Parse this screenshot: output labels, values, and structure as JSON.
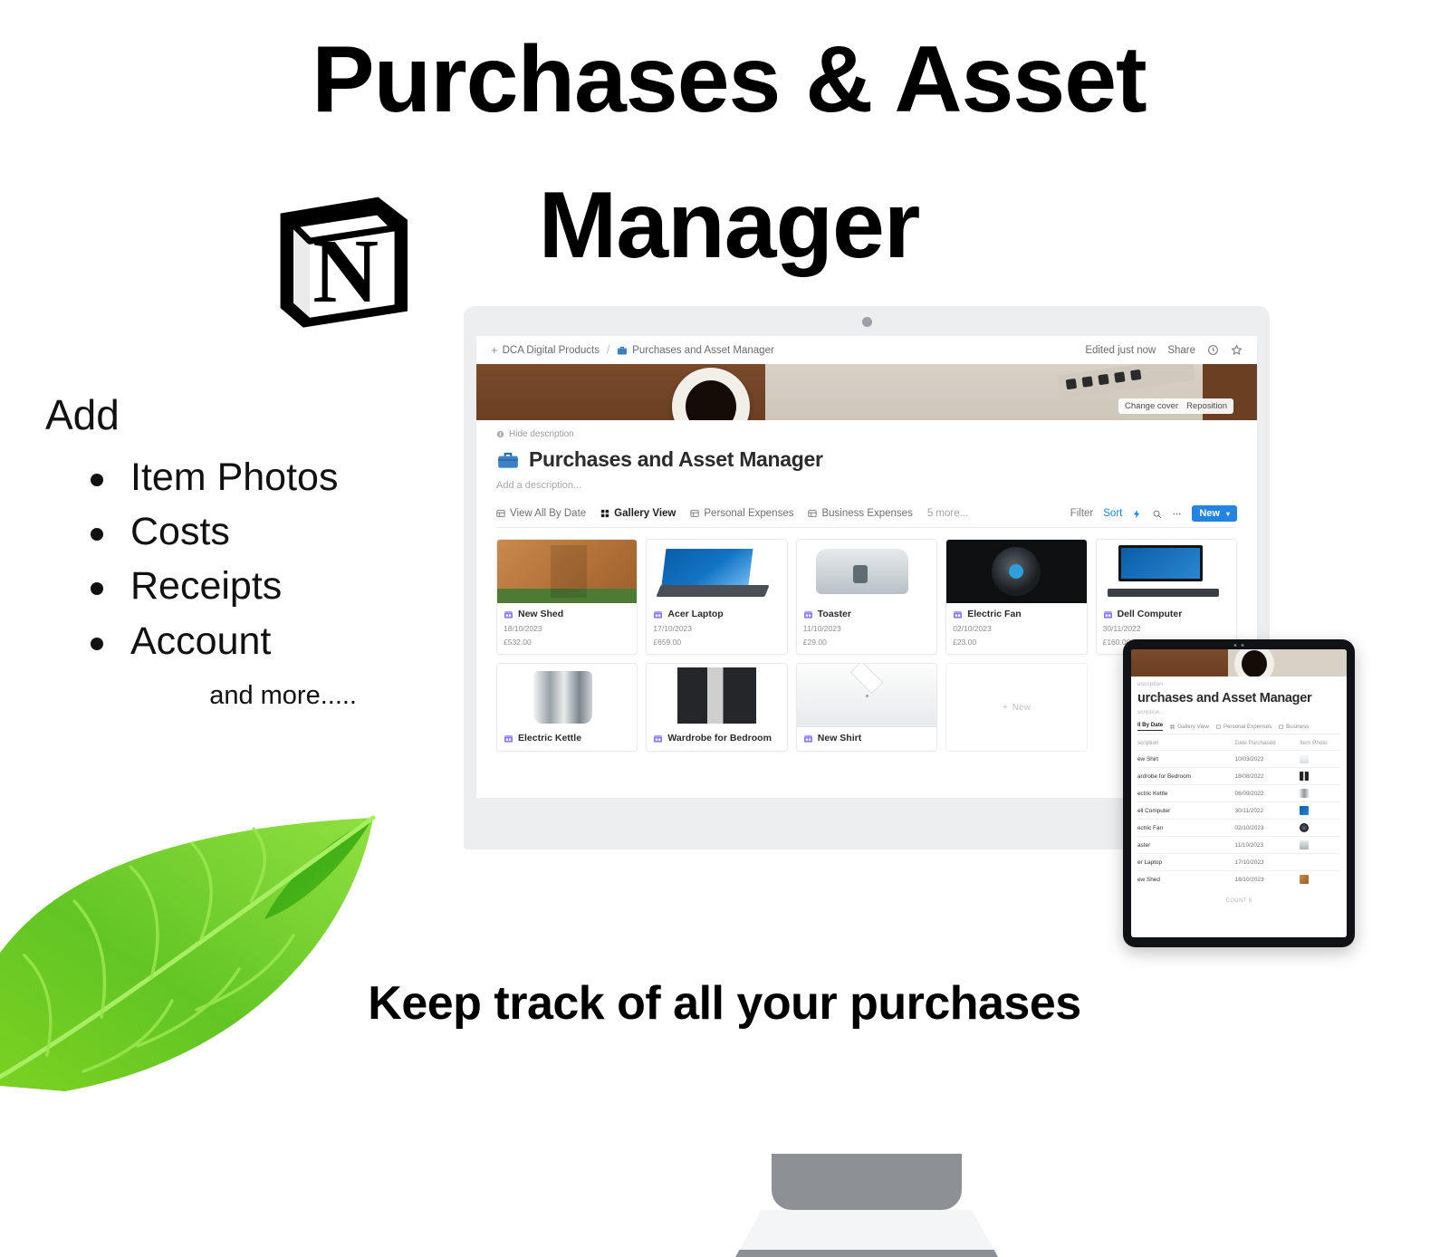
{
  "hero": {
    "title_line1": "Purchases & Asset",
    "title_line2": "Manager",
    "logo_name": "notion-logo"
  },
  "features": {
    "heading": "Add",
    "items": [
      "Item Photos",
      "Costs",
      "Receipts",
      "Account"
    ],
    "more": "and more....."
  },
  "tagline": "Keep track of all your purchases",
  "notion": {
    "breadcrumb": {
      "plus": "+",
      "workspace": "DCA Digital Products",
      "separator": "/",
      "page": "Purchases and Asset Manager"
    },
    "topbar_right": {
      "edited": "Edited just now",
      "share": "Share",
      "comment_icon": "clock-icon",
      "favorite_icon": "star-icon"
    },
    "cover": {
      "change_cover": "Change cover",
      "reposition": "Reposition"
    },
    "hide_description": "Hide description",
    "page_title": "Purchases and Asset Manager",
    "description_placeholder": "Add a description...",
    "tabs": [
      {
        "label": "View All By Date",
        "icon": "table-icon",
        "active": false
      },
      {
        "label": "Gallery View",
        "icon": "gallery-icon",
        "active": true
      },
      {
        "label": "Personal Expenses",
        "icon": "table-icon",
        "active": false
      },
      {
        "label": "Business Expenses",
        "icon": "table-icon",
        "active": false
      }
    ],
    "more_tabs": "5 more...",
    "tools": {
      "filter": "Filter",
      "sort": "Sort",
      "lightning_icon": "lightning-icon",
      "search_icon": "search-icon",
      "more_icon": "ellipsis-icon",
      "new_label": "New",
      "new_chevron": "▾"
    },
    "cards": [
      {
        "name": "New Shed",
        "date": "18/10/2023",
        "price": "£532.00",
        "thumb": "shed"
      },
      {
        "name": "Acer Laptop",
        "date": "17/10/2023",
        "price": "£659.00",
        "thumb": "laptop"
      },
      {
        "name": "Toaster",
        "date": "11/10/2023",
        "price": "£29.00",
        "thumb": "toaster"
      },
      {
        "name": "Electric Fan",
        "date": "02/10/2023",
        "price": "£23.00",
        "thumb": "fan"
      },
      {
        "name": "Dell Computer",
        "date": "30/11/2022",
        "price": "£160.00",
        "thumb": "dell"
      },
      {
        "name": "Electric Kettle",
        "date": "",
        "price": "",
        "thumb": "kettle"
      },
      {
        "name": "Wardrobe for Bedroom",
        "date": "",
        "price": "",
        "thumb": "wardrobe"
      },
      {
        "name": "New Shirt",
        "date": "",
        "price": "",
        "thumb": "shirt"
      }
    ],
    "new_card_label": "New"
  },
  "tablet": {
    "hide_description": "escription",
    "page_title": "urchases and Asset Manager",
    "description_placeholder": "scription...",
    "tabs": [
      {
        "label": "ll By Date",
        "active": true
      },
      {
        "label": "Gallery View",
        "active": false
      },
      {
        "label": "Personal Expenses",
        "active": false
      },
      {
        "label": "Business",
        "active": false
      }
    ],
    "columns": [
      "scription",
      "Date Purchased",
      "Item Photo"
    ],
    "rows": [
      {
        "name": "ew Shirt",
        "date": "10/03/2022",
        "thumb": "shirt"
      },
      {
        "name": "ardrobe for Bedroom",
        "date": "18/08/2022",
        "thumb": "wardrobe"
      },
      {
        "name": "ectric Kettle",
        "date": "06/09/2022",
        "thumb": "kettle"
      },
      {
        "name": "ell Computer",
        "date": "30/11/2022",
        "thumb": "dell"
      },
      {
        "name": "ectric Fan",
        "date": "02/10/2023",
        "thumb": "fan"
      },
      {
        "name": "aster",
        "date": "11/10/2023",
        "thumb": "toaster"
      },
      {
        "name": "er Laptop",
        "date": "17/10/2023",
        "thumb": "laptop"
      },
      {
        "name": "ew Shed",
        "date": "18/10/2023",
        "thumb": "shed"
      }
    ],
    "count_label": "COUNT 8"
  },
  "colors": {
    "accent_blue": "#2383e2",
    "leaf_green": "#5dc21e",
    "text_dark": "#111111"
  }
}
